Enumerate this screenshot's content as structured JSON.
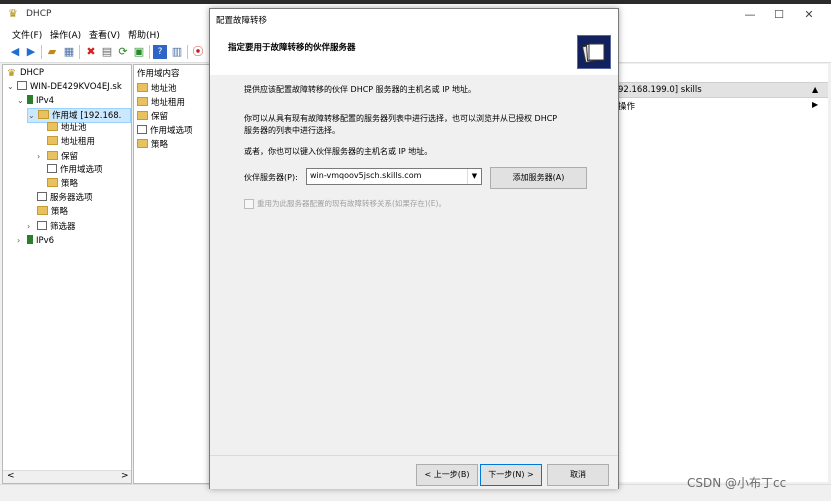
{
  "window": {
    "title": "DHCP",
    "controls": {
      "minimize": "—",
      "maximize": "☐",
      "close": "✕"
    }
  },
  "menu": [
    "文件(F)",
    "操作(A)",
    "查看(V)",
    "帮助(H)"
  ],
  "toolbar_icons": [
    "back-arrow-icon",
    "forward-arrow-icon",
    "up-folder-icon",
    "console-tree-icon",
    "delete-icon",
    "properties-icon",
    "refresh-icon",
    "export-icon",
    "help-icon",
    "view-icon",
    "stop-icon"
  ],
  "tree": [
    {
      "label": "DHCP",
      "level": 0,
      "arrow": ""
    },
    {
      "label": "WIN-DE429KVO4EJ.sk",
      "level": 0,
      "arrow": "v"
    },
    {
      "label": "IPv4",
      "level": 1,
      "arrow": "v"
    },
    {
      "label": "作用域 [192.168.",
      "level": 2,
      "arrow": "v"
    },
    {
      "label": "地址池",
      "level": 3,
      "arrow": ""
    },
    {
      "label": "地址租用",
      "level": 3,
      "arrow": ""
    },
    {
      "label": "保留",
      "level": 3,
      "arrow": ">"
    },
    {
      "label": "作用域选项",
      "level": 3,
      "arrow": ""
    },
    {
      "label": "策略",
      "level": 3,
      "arrow": ""
    },
    {
      "label": "服务器选项",
      "level": 2,
      "arrow": ""
    },
    {
      "label": "策略",
      "level": 2,
      "arrow": ""
    },
    {
      "label": "筛选器",
      "level": 2,
      "arrow": ">"
    },
    {
      "label": "IPv6",
      "level": 1,
      "arrow": ">"
    }
  ],
  "middle": {
    "header": "作用域内容",
    "items": [
      "地址池",
      "地址租用",
      "保留",
      "作用域选项",
      "策略"
    ]
  },
  "right": {
    "header": "92.168.199.0] skills",
    "action": "操作"
  },
  "dialog": {
    "title": "配置故障转移",
    "heading": "指定要用于故障转移的伙伴服务器",
    "para1": "提供应该配置故障转移的伙伴 DHCP 服务器的主机名或 IP 地址。",
    "para2_line1": "你可以从具有现有故障转移配置的服务器列表中进行选择，也可以浏览并从已授权 DHCP",
    "para2_line2": "服务器的列表中进行选择。",
    "para3": "或者，你也可以键入伙伴服务器的主机名或 IP 地址。",
    "partner_label": "伙伴服务器(P):",
    "partner_value": "win-vmqoov5jsch.skills.com",
    "add_server": "添加服务器(A)",
    "reuse_label": "重用为此服务器配置的现有故障转移关系(如果存在)(E)。",
    "back": "< 上一步(B)",
    "next": "下一步(N) >",
    "cancel": "取消"
  },
  "watermark": "CSDN @小布丁cc",
  "scroll": {
    "left": "<",
    "right": ">"
  }
}
